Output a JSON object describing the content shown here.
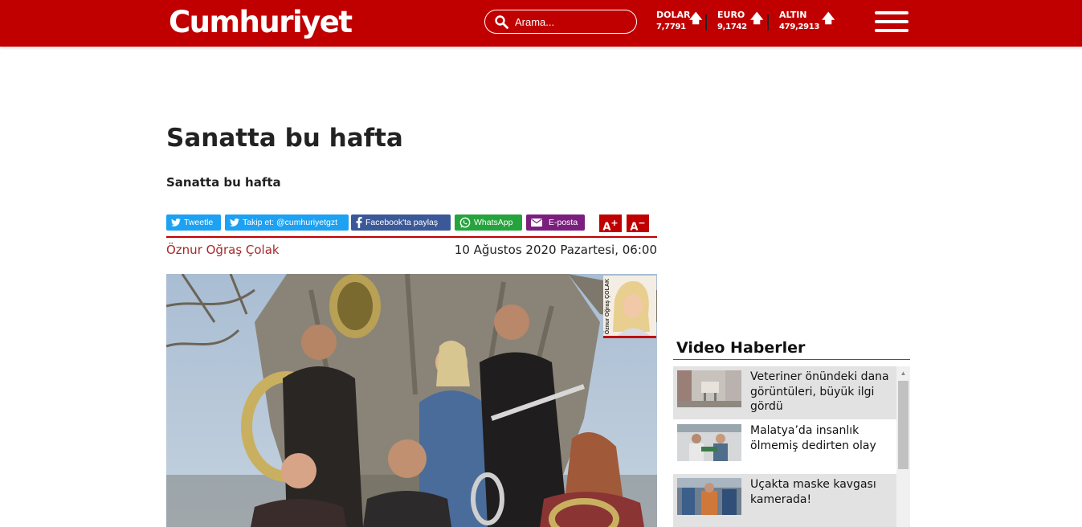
{
  "header": {
    "logo": "Cumhuriyet",
    "search_placeholder": "Arama...",
    "rates": [
      {
        "name": "DOLAR",
        "value": "7,7791",
        "trend": "up"
      },
      {
        "name": "EURO",
        "value": "9,1742",
        "trend": "up"
      },
      {
        "name": "ALTIN",
        "value": "479,2913",
        "trend": "up"
      }
    ],
    "arrow_glyph": "🡅"
  },
  "article": {
    "title": "Sanatta bu hafta",
    "subtitle": "Sanatta bu hafta",
    "author": "Öznur Oğraş Çolak",
    "date": "10 Ağustos 2020 Pazartesi, 06:00",
    "author_photo_label": "Öznur Oğraş ÇOLAK",
    "share": {
      "tweet": "Tweetle",
      "follow": "Takip et: @cumhuriyetgzt",
      "facebook": "Facebook'ta paylaş",
      "whatsapp": "WhatsApp",
      "email": "E-posta"
    },
    "font_increase": "A",
    "font_decrease": "A"
  },
  "sidebar": {
    "title": "Video Haberler",
    "items": [
      {
        "text": "Veteriner önündeki dana görüntüleri, büyük ilgi gördü"
      },
      {
        "text": "Malatya’da insanlık ölmemiş dedirten olay"
      },
      {
        "text": "Uçakta maske kavgası kamerada!"
      }
    ]
  },
  "colors": {
    "brand_red": "#c00000",
    "twitter": "#1da1f2",
    "facebook": "#3b5998",
    "whatsapp": "#25a33c",
    "email": "#7b1f7f"
  }
}
